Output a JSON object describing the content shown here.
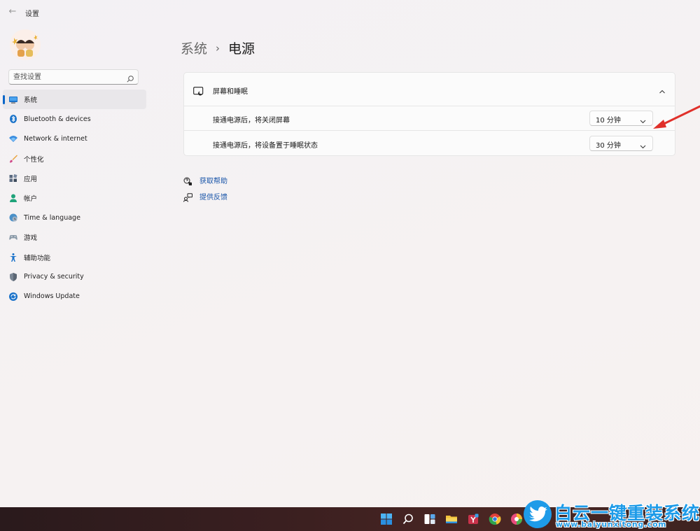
{
  "window": {
    "title": "设置"
  },
  "search": {
    "placeholder": "查找设置"
  },
  "sidebar": {
    "items": [
      {
        "label": "系统",
        "icon": "monitor-icon",
        "active": true
      },
      {
        "label": "Bluetooth & devices",
        "icon": "bluetooth-icon"
      },
      {
        "label": "Network & internet",
        "icon": "wifi-icon"
      },
      {
        "label": "个性化",
        "icon": "brush-icon"
      },
      {
        "label": "应用",
        "icon": "apps-icon"
      },
      {
        "label": "帐户",
        "icon": "person-icon"
      },
      {
        "label": "Time & language",
        "icon": "globe-clock-icon"
      },
      {
        "label": "游戏",
        "icon": "gamepad-icon"
      },
      {
        "label": "辅助功能",
        "icon": "accessibility-icon"
      },
      {
        "label": "Privacy & security",
        "icon": "shield-icon"
      },
      {
        "label": "Windows Update",
        "icon": "update-icon"
      }
    ]
  },
  "breadcrumb": {
    "parent": "系统",
    "separator": "›",
    "current": "电源"
  },
  "screen_sleep": {
    "title": "屏幕和睡眠",
    "rows": [
      {
        "label": "接通电源后，将关闭屏幕",
        "value": "10 分钟"
      },
      {
        "label": "接通电源后，将设备置于睡眠状态",
        "value": "30 分钟"
      }
    ]
  },
  "links": {
    "help": "获取帮助",
    "feedback": "提供反馈"
  },
  "watermark": {
    "title": "白云一键重装系统",
    "url": "www.baiyunxitong.com"
  },
  "colors": {
    "accent": "#0a66c8",
    "link": "#1754a8",
    "arrow": "#e0302a",
    "watermark": "#1e9be8"
  }
}
